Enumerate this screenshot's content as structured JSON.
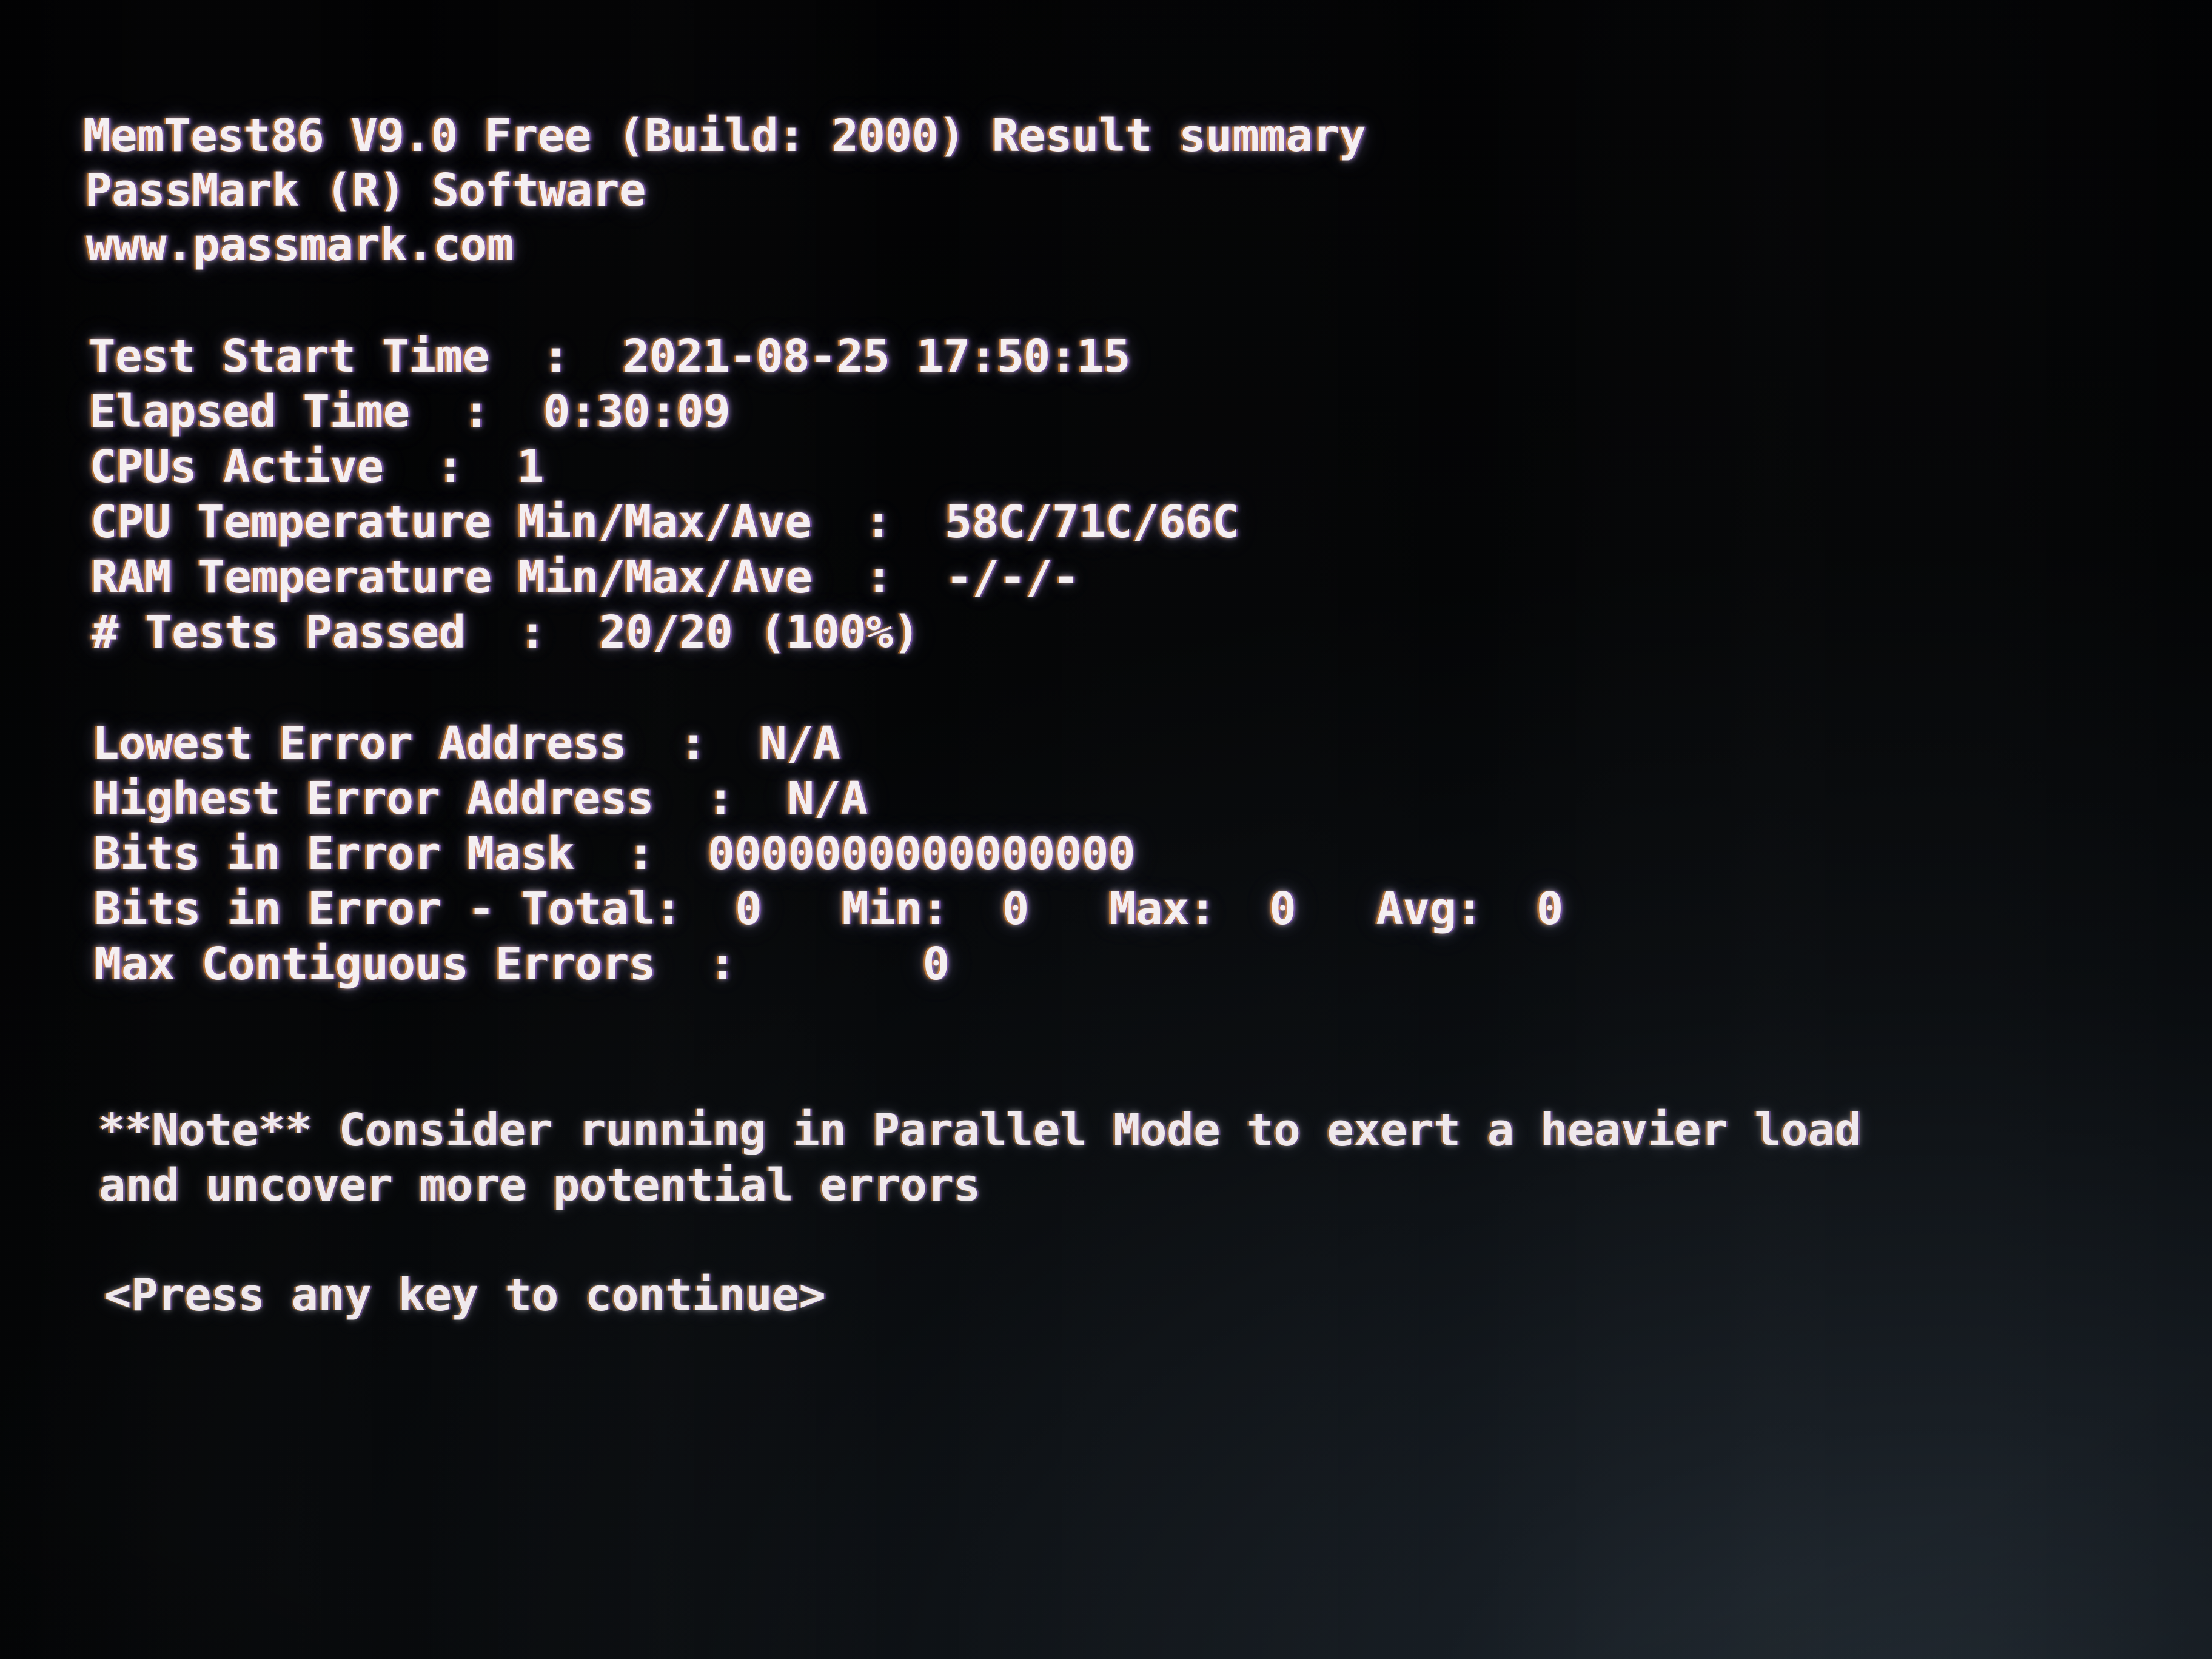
{
  "app": {
    "title": "MemTest86 V9.0 Free (Build: 2000) Result summary",
    "vendor": "PassMark (R) Software",
    "website": "www.passmark.com"
  },
  "summary": {
    "rows": [
      {
        "label": "Test Start Time",
        "separator": ":",
        "value": "2021-08-25 17:50:15"
      },
      {
        "label": "Elapsed Time",
        "separator": ":",
        "value": "0:30:09"
      },
      {
        "label": "CPUs Active",
        "separator": ":",
        "value": "1"
      },
      {
        "label": "CPU Temperature Min/Max/Ave",
        "separator": ":",
        "value": "58C/71C/66C"
      },
      {
        "label": "RAM Temperature Min/Max/Ave",
        "separator": ":",
        "value": "-/-/-"
      },
      {
        "label": "# Tests Passed",
        "separator": ":",
        "value": "20/20 (100%)"
      }
    ]
  },
  "errors": {
    "rows": [
      {
        "label": "Lowest Error Address",
        "separator": ":",
        "value": "N/A"
      },
      {
        "label": "Highest Error Address",
        "separator": ":",
        "value": "N/A"
      },
      {
        "label": "Bits in Error Mask",
        "separator": ":",
        "value": "0000000000000000"
      },
      {
        "label": "Max Contiguous Errors",
        "separator": ":",
        "value": "0"
      }
    ],
    "bits_in_error": {
      "label": "Bits in Error - Total:",
      "total": "0",
      "min_label": "Min:",
      "min": "0",
      "max_label": "Max:",
      "max": "0",
      "avg_label": "Avg:",
      "avg": "0"
    }
  },
  "note": {
    "line1": "**Note** Consider running in Parallel Mode to exert a heavier load",
    "line2": "and uncover more potential errors"
  },
  "prompt": {
    "text": "<Press any key to continue>"
  },
  "lines": {
    "l01": "MemTest86 V9.0 Free (Build: 2000) Result summary",
    "l02": "PassMark (R) Software",
    "l03": "www.passmark.com",
    "l04": "Test Start Time  :  2021-08-25 17:50:15",
    "l05": "Elapsed Time  :  0:30:09",
    "l06": "CPUs Active  :  1",
    "l07": "CPU Temperature Min/Max/Ave  :  58C/71C/66C",
    "l08": "RAM Temperature Min/Max/Ave  :  -/-/-",
    "l09": "# Tests Passed  :  20/20 (100%)",
    "l10": "Lowest Error Address  :  N/A",
    "l11": "Highest Error Address  :  N/A",
    "l12": "Bits in Error Mask  :  0000000000000000",
    "l13": "Bits in Error - Total:  0   Min:  0   Max:  0   Avg:  0",
    "l14": "Max Contiguous Errors  :       0",
    "l15": "**Note** Consider running in Parallel Mode to exert a heavier load",
    "l16": "and uncover more potential errors",
    "l17": "<Press any key to continue>"
  },
  "colors": {
    "text": "#f4eff1",
    "background": "#000000",
    "glow_warm": "#ff9628",
    "glow_cool": "#965adc"
  }
}
